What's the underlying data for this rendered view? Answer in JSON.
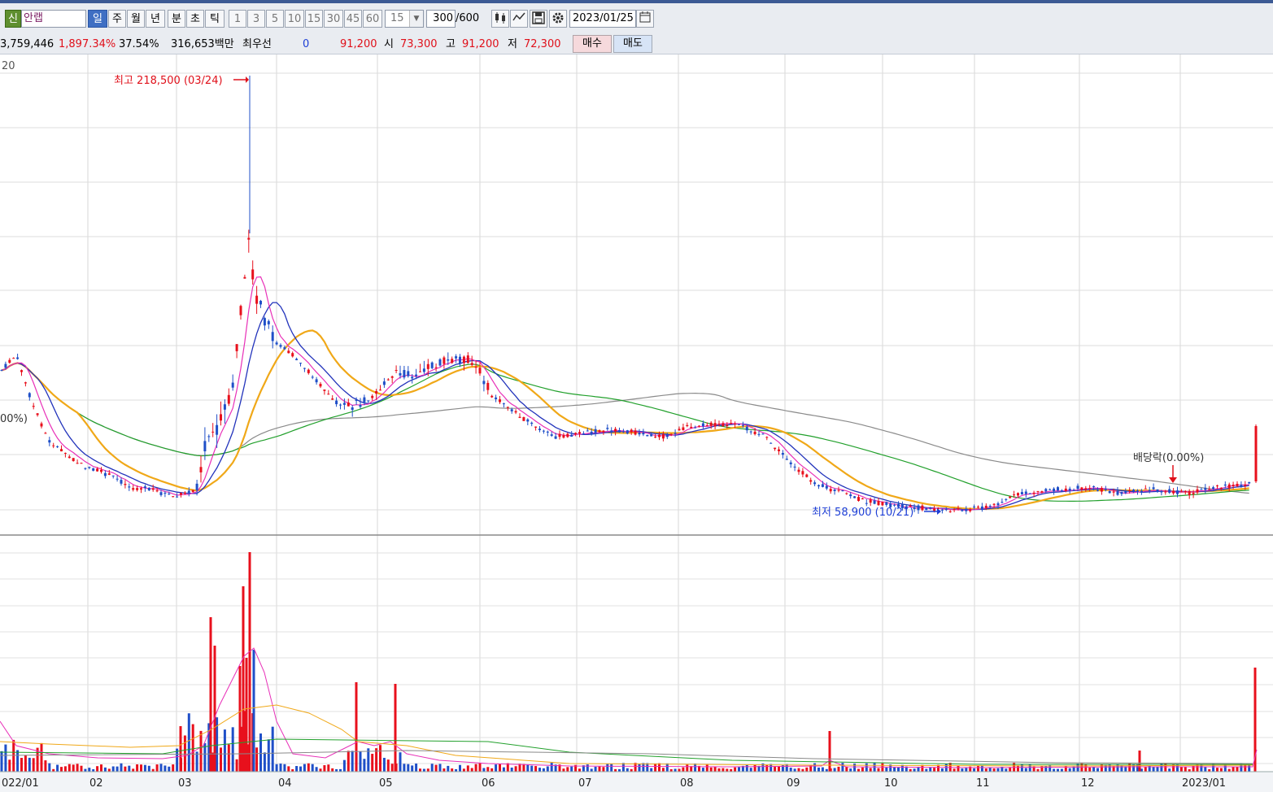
{
  "toolbar": {
    "new_badge": "신",
    "stock_name": "안랩",
    "periods": [
      "일",
      "주",
      "월",
      "년",
      "분",
      "초",
      "틱"
    ],
    "active_period": "일",
    "intervals": [
      "1",
      "3",
      "5",
      "10",
      "15",
      "30",
      "45",
      "60"
    ],
    "interval_select": "15",
    "count": "300",
    "count_total": "/600",
    "date": "2023/01/25"
  },
  "info": {
    "volume": "3,759,446",
    "volume_ratio": "1,897.34%",
    "turnover": "37.54%",
    "amount": "316,653백만",
    "best_label": "최우선",
    "best_value": "0",
    "current": "91,200",
    "open_label": "시",
    "open": "73,300",
    "high_label": "고",
    "high": "91,200",
    "low_label": "저",
    "low": "72,300",
    "buy_label": "매수",
    "sell_label": "매도"
  },
  "chart_labels": {
    "corner_tick": "20",
    "left_pct": "00%)",
    "high_annotation": "최고 218,500 (03/24)",
    "low_annotation": "최저 58,900 (10/21)",
    "dividend_annotation": "배당락(0.00%)"
  },
  "chart_data": {
    "type": "candlestick",
    "months": [
      "022/01",
      "02",
      "03",
      "04",
      "05",
      "06",
      "07",
      "08",
      "09",
      "10",
      "11",
      "12",
      "2023/01"
    ],
    "high_value": 218500,
    "high_date": "03/24",
    "low_value": 58900,
    "low_date": "10/21",
    "latest_close": 91200,
    "series_colors": {
      "up": "#e8101c",
      "down": "#1f4fc8",
      "ma5": "#e830b8",
      "ma10": "#2233bb",
      "ma20": "#f0a818",
      "ma60": "#22a02c",
      "ma120": "#8a8a8a"
    }
  }
}
